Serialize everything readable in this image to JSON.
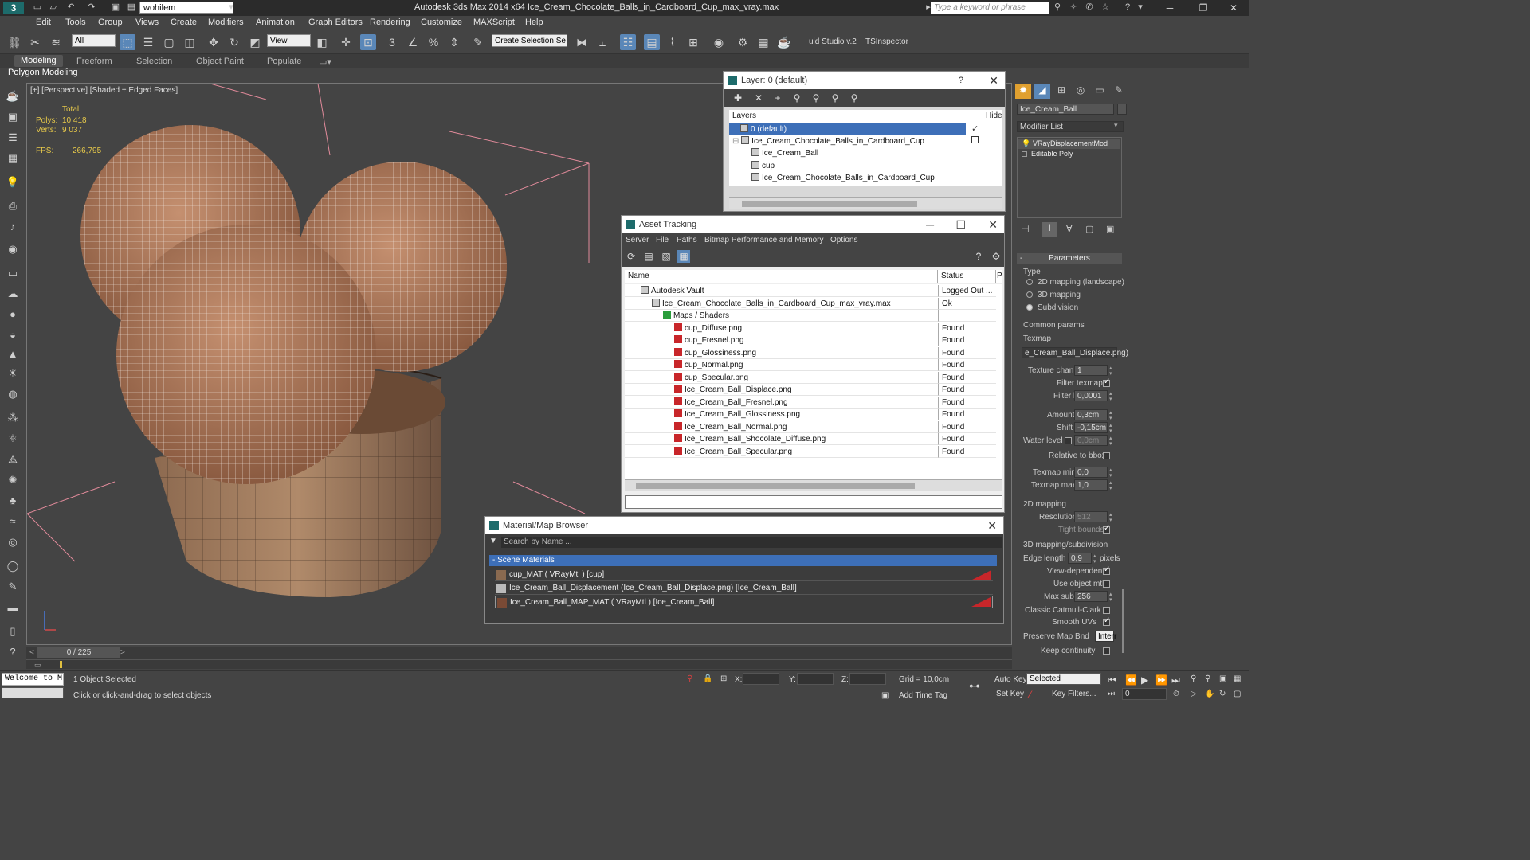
{
  "app": {
    "title": "Autodesk 3ds Max  2014 x64     Ice_Cream_Chocolate_Balls_in_Cardboard_Cup_max_vray.max",
    "workspace": "wohilem",
    "search_placeholder": "Type a keyword or phrase",
    "logo": "3"
  },
  "menu": [
    "Edit",
    "Tools",
    "Group",
    "Views",
    "Create",
    "Modifiers",
    "Animation",
    "Graph Editors",
    "Rendering",
    "Customize",
    "MAXScript",
    "Help"
  ],
  "toolbar": {
    "filter_combo": "All",
    "view_combo": "View",
    "selection_set": "Create Selection Se",
    "studio_label": "uid Studio v.2",
    "tsinspector": "TSInspector"
  },
  "ribbon": {
    "tabs": [
      "Modeling",
      "Freeform",
      "Selection",
      "Object Paint",
      "Populate"
    ],
    "active": "Modeling",
    "sub": "Polygon Modeling"
  },
  "viewport": {
    "label": "[+] [Perspective] [Shaded + Edged Faces]",
    "stats_total": "Total",
    "polys_label": "Polys:",
    "polys_value": "10 418",
    "verts_label": "Verts:",
    "verts_value": "9 037",
    "fps_label": "FPS:",
    "fps_value": "266,795"
  },
  "layer_window": {
    "title": "Layer: 0 (default)",
    "col_layers": "Layers",
    "col_hide": "Hide",
    "rows": [
      {
        "name": "0 (default)",
        "indent": 0,
        "selected": true
      },
      {
        "name": "Ice_Cream_Chocolate_Balls_in_Cardboard_Cup",
        "indent": 0,
        "selected": false
      },
      {
        "name": "Ice_Cream_Ball",
        "indent": 1,
        "selected": false
      },
      {
        "name": "cup",
        "indent": 1,
        "selected": false
      },
      {
        "name": "Ice_Cream_Chocolate_Balls_in_Cardboard_Cup",
        "indent": 1,
        "selected": false
      }
    ]
  },
  "asset_window": {
    "title": "Asset Tracking",
    "menu": [
      "Server",
      "File",
      "Paths",
      "Bitmap Performance and Memory",
      "Options"
    ],
    "col_name": "Name",
    "col_status": "Status",
    "col_p": "P",
    "rows": [
      {
        "name": "Autodesk Vault",
        "status": "Logged Out ...",
        "indent": 0,
        "icon": "vault"
      },
      {
        "name": "Ice_Cream_Chocolate_Balls_in_Cardboard_Cup_max_vray.max",
        "status": "Ok",
        "indent": 1,
        "icon": "max"
      },
      {
        "name": "Maps / Shaders",
        "status": "",
        "indent": 2,
        "icon": "folder"
      },
      {
        "name": "cup_Diffuse.png",
        "status": "Found",
        "indent": 3,
        "icon": "map"
      },
      {
        "name": "cup_Fresnel.png",
        "status": "Found",
        "indent": 3,
        "icon": "map"
      },
      {
        "name": "cup_Glossiness.png",
        "status": "Found",
        "indent": 3,
        "icon": "map"
      },
      {
        "name": "cup_Normal.png",
        "status": "Found",
        "indent": 3,
        "icon": "map"
      },
      {
        "name": "cup_Specular.png",
        "status": "Found",
        "indent": 3,
        "icon": "map"
      },
      {
        "name": "Ice_Cream_Ball_Displace.png",
        "status": "Found",
        "indent": 3,
        "icon": "map"
      },
      {
        "name": "Ice_Cream_Ball_Fresnel.png",
        "status": "Found",
        "indent": 3,
        "icon": "map"
      },
      {
        "name": "Ice_Cream_Ball_Glossiness.png",
        "status": "Found",
        "indent": 3,
        "icon": "map"
      },
      {
        "name": "Ice_Cream_Ball_Normal.png",
        "status": "Found",
        "indent": 3,
        "icon": "map"
      },
      {
        "name": "Ice_Cream_Ball_Shocolate_Diffuse.png",
        "status": "Found",
        "indent": 3,
        "icon": "map"
      },
      {
        "name": "Ice_Cream_Ball_Specular.png",
        "status": "Found",
        "indent": 3,
        "icon": "map"
      }
    ]
  },
  "material_browser": {
    "title": "Material/Map Browser",
    "search_placeholder": "Search by Name ...",
    "group": "- Scene Materials",
    "items": [
      "cup_MAT  ( VRayMtl )  [cup]",
      "Ice_Cream_Ball_Displacement (Ice_Cream_Ball_Displace.png) [Ice_Cream_Ball]",
      "Ice_Cream_Ball_MAP_MAT  ( VRayMtl )  [Ice_Cream_Ball]"
    ]
  },
  "command_panel": {
    "object_name": "Ice_Cream_Ball",
    "modifier_list": "Modifier List",
    "stack": [
      "VRayDisplacementMod",
      "Editable Poly"
    ],
    "rollout": "Parameters",
    "type_label": "Type",
    "type_options": [
      "2D mapping (landscape)",
      "3D mapping",
      "Subdivision"
    ],
    "common_params": "Common params",
    "texmap_label": "Texmap",
    "texmap_value": "e_Cream_Ball_Displace.png)",
    "texture_chan_label": "Texture chan",
    "texture_chan_value": "1",
    "filter_texmap_label": "Filter texmap",
    "filter_blur_label": "Filter blur",
    "filter_blur_value": "0,0001",
    "amount_label": "Amount",
    "amount_value": "0,3cm",
    "shift_label": "Shift",
    "shift_value": "-0,15cm",
    "water_label": "Water level",
    "water_value": "0,0cm",
    "relative_label": "Relative to bbox",
    "texmap_min_label": "Texmap min",
    "texmap_min_value": "0,0",
    "texmap_max_label": "Texmap max",
    "texmap_max_value": "1,0",
    "mapping2d": "2D mapping",
    "resolution_label": "Resolution",
    "resolution_value": "512",
    "tight_label": "Tight bounds",
    "mapping3d": "3D mapping/subdivision",
    "edge_label": "Edge length",
    "edge_value": "0,9",
    "edge_unit": "pixels",
    "view_dep_label": "View-dependent",
    "use_obj_label": "Use object mtl",
    "max_subdivs_label": "Max subdivs",
    "max_subdivs_value": "256",
    "catmull_label": "Classic Catmull-Clark",
    "smooth_label": "Smooth UVs",
    "preserve_label": "Preserve Map Bnd",
    "preserve_value": "Interr",
    "keep_label": "Keep continuity"
  },
  "timeline": {
    "frame": "0 / 225"
  },
  "status": {
    "listener": "Welcome to M",
    "selected": "1 Object Selected",
    "prompt": "Click or click-and-drag to select objects",
    "x_label": "X:",
    "y_label": "Y:",
    "z_label": "Z:",
    "grid": "Grid = 10,0cm",
    "add_time_tag": "Add Time Tag",
    "auto_key": "Auto Key",
    "set_key": "Set Key",
    "selected_combo": "Selected",
    "key_filters": "Key Filters...",
    "frame_field": "0"
  }
}
